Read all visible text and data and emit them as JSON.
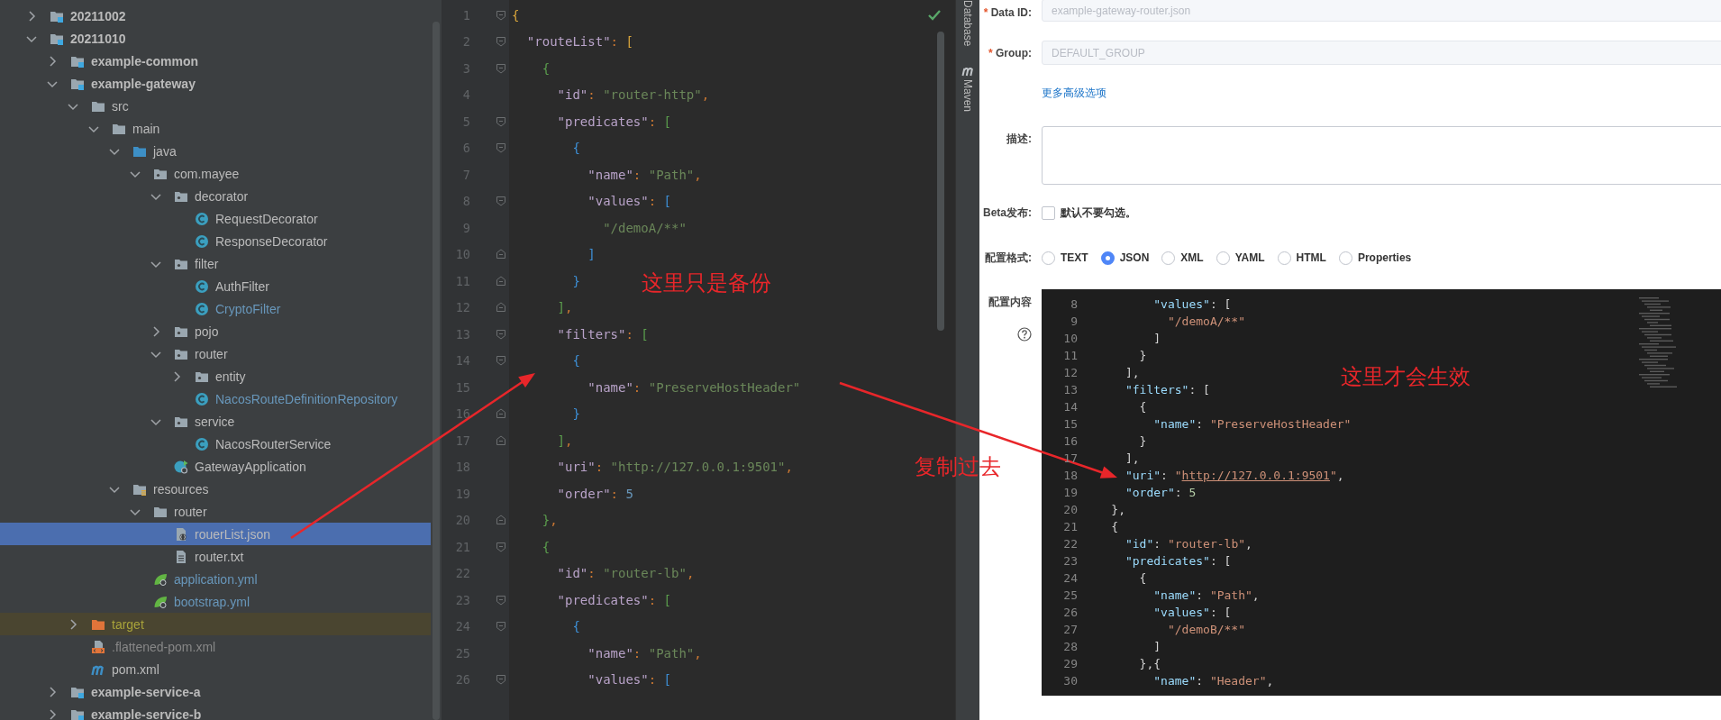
{
  "tree": [
    {
      "name": "20211002",
      "kind": "module",
      "expanded": false,
      "selected": false,
      "color": "#bbbbbb"
    },
    {
      "name": "20211010",
      "kind": "module",
      "expanded": true,
      "selected": false,
      "color": "#bbbbbb",
      "children": [
        {
          "name": "example-common",
          "kind": "module",
          "expanded": false,
          "selected": false,
          "color": "#bbbbbb"
        },
        {
          "name": "example-gateway",
          "kind": "module",
          "expanded": true,
          "selected": false,
          "color": "#bbbbbb",
          "children": [
            {
              "name": "src",
              "kind": "folder",
              "expanded": true,
              "selected": false,
              "color": "#bbbbbb",
              "children": [
                {
                  "name": "main",
                  "kind": "folder",
                  "expanded": true,
                  "selected": false,
                  "color": "#bbbbbb",
                  "children": [
                    {
                      "name": "java",
                      "kind": "source",
                      "expanded": true,
                      "selected": false,
                      "color": "#bbbbbb",
                      "children": [
                        {
                          "name": "com.mayee",
                          "kind": "package",
                          "expanded": true,
                          "selected": false,
                          "color": "#bbbbbb",
                          "children": [
                            {
                              "name": "decorator",
                              "kind": "package",
                              "expanded": true,
                              "selected": false,
                              "color": "#bbbbbb",
                              "children": [
                                {
                                  "name": "RequestDecorator",
                                  "kind": "class",
                                  "selected": false,
                                  "color": "#bbbbbb"
                                },
                                {
                                  "name": "ResponseDecorator",
                                  "kind": "class",
                                  "selected": false,
                                  "color": "#bbbbbb"
                                }
                              ]
                            },
                            {
                              "name": "filter",
                              "kind": "package",
                              "expanded": true,
                              "selected": false,
                              "color": "#bbbbbb",
                              "children": [
                                {
                                  "name": "AuthFilter",
                                  "kind": "class",
                                  "selected": false,
                                  "color": "#bbbbbb"
                                },
                                {
                                  "name": "CryptoFilter",
                                  "kind": "class",
                                  "selected": false,
                                  "color": "#6897bb"
                                }
                              ]
                            },
                            {
                              "name": "pojo",
                              "kind": "package",
                              "expanded": false,
                              "selected": false,
                              "color": "#bbbbbb"
                            },
                            {
                              "name": "router",
                              "kind": "package",
                              "expanded": true,
                              "selected": false,
                              "color": "#bbbbbb",
                              "children": [
                                {
                                  "name": "entity",
                                  "kind": "package",
                                  "expanded": false,
                                  "selected": false,
                                  "color": "#bbbbbb"
                                },
                                {
                                  "name": "NacosRouteDefinitionRepository",
                                  "kind": "class",
                                  "selected": false,
                                  "color": "#6897bb"
                                }
                              ]
                            },
                            {
                              "name": "service",
                              "kind": "package",
                              "expanded": true,
                              "selected": false,
                              "color": "#bbbbbb",
                              "children": [
                                {
                                  "name": "NacosRouterService",
                                  "kind": "class",
                                  "selected": false,
                                  "color": "#bbbbbb"
                                }
                              ]
                            },
                            {
                              "name": "GatewayApplication",
                              "kind": "app",
                              "selected": false,
                              "color": "#bbbbbb"
                            }
                          ]
                        }
                      ]
                    },
                    {
                      "name": "resources",
                      "kind": "resources",
                      "expanded": true,
                      "selected": false,
                      "color": "#bbbbbb",
                      "children": [
                        {
                          "name": "router",
                          "kind": "folder",
                          "expanded": true,
                          "selected": false,
                          "color": "#bbbbbb",
                          "children": [
                            {
                              "name": "rouerList.json",
                              "kind": "json",
                              "selected": true,
                              "color": "#bbbbbb"
                            },
                            {
                              "name": "router.txt",
                              "kind": "text",
                              "selected": false,
                              "color": "#bbbbbb"
                            }
                          ]
                        },
                        {
                          "name": "application.yml",
                          "kind": "yaml",
                          "selected": false,
                          "color": "#6897bb"
                        },
                        {
                          "name": "bootstrap.yml",
                          "kind": "yaml",
                          "selected": false,
                          "color": "#6897bb"
                        }
                      ]
                    }
                  ]
                }
              ]
            },
            {
              "name": "target",
              "kind": "excluded",
              "expanded": false,
              "selected": false,
              "color": "#a8a33a"
            },
            {
              "name": ".flattened-pom.xml",
              "kind": "xml",
              "selected": false,
              "color": "#878787"
            },
            {
              "name": "pom.xml",
              "kind": "maven",
              "selected": false,
              "color": "#bbbbbb"
            }
          ]
        },
        {
          "name": "example-service-a",
          "kind": "module",
          "expanded": false,
          "selected": false,
          "color": "#bbbbbb"
        },
        {
          "name": "example-service-b",
          "kind": "module",
          "expanded": false,
          "selected": false,
          "color": "#bbbbbb"
        }
      ]
    }
  ],
  "editor": {
    "lines": [
      {
        "number": "1",
        "fold_start": true,
        "fold_end": false,
        "tokens": [
          {
            "kind": "bracket",
            "color": "#d9a53b",
            "text": "{"
          }
        ]
      },
      {
        "number": "2",
        "fold_start": true,
        "fold_end": false,
        "tokens": [
          {
            "kind": "key",
            "text": "  \"routeList\""
          },
          {
            "kind": "punct",
            "text": ": "
          },
          {
            "kind": "bracket",
            "color": "#d9a53b",
            "text": "["
          }
        ]
      },
      {
        "number": "3",
        "fold_start": true,
        "fold_end": false,
        "tokens": [
          {
            "kind": "bracket",
            "color": "#5b9e4d",
            "text": "    {"
          }
        ]
      },
      {
        "number": "4",
        "fold_start": false,
        "fold_end": false,
        "tokens": [
          {
            "kind": "key",
            "text": "      \"id\""
          },
          {
            "kind": "punct",
            "text": ": "
          },
          {
            "kind": "string",
            "text": "\"router-http\""
          },
          {
            "kind": "punct",
            "text": ","
          }
        ]
      },
      {
        "number": "5",
        "fold_start": true,
        "fold_end": false,
        "tokens": [
          {
            "kind": "key",
            "text": "      \"predicates\""
          },
          {
            "kind": "punct",
            "text": ": "
          },
          {
            "kind": "bracket",
            "color": "#5b9e4d",
            "text": "["
          }
        ]
      },
      {
        "number": "6",
        "fold_start": true,
        "fold_end": false,
        "tokens": [
          {
            "kind": "bracket",
            "color": "#3d8fd6",
            "text": "        {"
          }
        ]
      },
      {
        "number": "7",
        "fold_start": false,
        "fold_end": false,
        "tokens": [
          {
            "kind": "key",
            "text": "          \"name\""
          },
          {
            "kind": "punct",
            "text": ": "
          },
          {
            "kind": "string",
            "text": "\"Path\""
          },
          {
            "kind": "punct",
            "text": ","
          }
        ]
      },
      {
        "number": "8",
        "fold_start": true,
        "fold_end": false,
        "tokens": [
          {
            "kind": "key",
            "text": "          \"values\""
          },
          {
            "kind": "punct",
            "text": ": "
          },
          {
            "kind": "bracket",
            "color": "#3d8fd6",
            "text": "["
          }
        ]
      },
      {
        "number": "9",
        "fold_start": false,
        "fold_end": false,
        "tokens": [
          {
            "kind": "string",
            "text": "            \"/demoA/**\""
          }
        ]
      },
      {
        "number": "10",
        "fold_start": false,
        "fold_end": true,
        "tokens": [
          {
            "kind": "bracket",
            "color": "#3d8fd6",
            "text": "          ]"
          }
        ]
      },
      {
        "number": "11",
        "fold_start": false,
        "fold_end": true,
        "tokens": [
          {
            "kind": "bracket",
            "color": "#3d8fd6",
            "text": "        }"
          }
        ]
      },
      {
        "number": "12",
        "fold_start": false,
        "fold_end": true,
        "tokens": [
          {
            "kind": "bracket",
            "color": "#5b9e4d",
            "text": "      ]"
          },
          {
            "kind": "punct",
            "text": ","
          }
        ]
      },
      {
        "number": "13",
        "fold_start": true,
        "fold_end": false,
        "tokens": [
          {
            "kind": "key",
            "text": "      \"filters\""
          },
          {
            "kind": "punct",
            "text": ": "
          },
          {
            "kind": "bracket",
            "color": "#5b9e4d",
            "text": "["
          }
        ]
      },
      {
        "number": "14",
        "fold_start": true,
        "fold_end": false,
        "tokens": [
          {
            "kind": "bracket",
            "color": "#3d8fd6",
            "text": "        {"
          }
        ]
      },
      {
        "number": "15",
        "fold_start": false,
        "fold_end": false,
        "tokens": [
          {
            "kind": "key",
            "text": "          \"name\""
          },
          {
            "kind": "punct",
            "text": ": "
          },
          {
            "kind": "string",
            "text": "\"PreserveHostHeader\""
          }
        ]
      },
      {
        "number": "16",
        "fold_start": false,
        "fold_end": true,
        "tokens": [
          {
            "kind": "bracket",
            "color": "#3d8fd6",
            "text": "        }"
          }
        ]
      },
      {
        "number": "17",
        "fold_start": false,
        "fold_end": true,
        "tokens": [
          {
            "kind": "bracket",
            "color": "#5b9e4d",
            "text": "      ]"
          },
          {
            "kind": "punct",
            "text": ","
          }
        ]
      },
      {
        "number": "18",
        "fold_start": false,
        "fold_end": false,
        "tokens": [
          {
            "kind": "key",
            "text": "      \"uri\""
          },
          {
            "kind": "punct",
            "text": ": "
          },
          {
            "kind": "string",
            "text": "\"http://127.0.0.1:9501\""
          },
          {
            "kind": "punct",
            "text": ","
          }
        ]
      },
      {
        "number": "19",
        "fold_start": false,
        "fold_end": false,
        "tokens": [
          {
            "kind": "key",
            "text": "      \"order\""
          },
          {
            "kind": "punct",
            "text": ": "
          },
          {
            "kind": "number",
            "text": "5"
          }
        ]
      },
      {
        "number": "20",
        "fold_start": false,
        "fold_end": true,
        "tokens": [
          {
            "kind": "bracket",
            "color": "#5b9e4d",
            "text": "    }"
          },
          {
            "kind": "punct",
            "text": ","
          }
        ]
      },
      {
        "number": "21",
        "fold_start": true,
        "fold_end": false,
        "tokens": [
          {
            "kind": "bracket",
            "color": "#5b9e4d",
            "text": "    {"
          }
        ]
      },
      {
        "number": "22",
        "fold_start": false,
        "fold_end": false,
        "tokens": [
          {
            "kind": "key",
            "text": "      \"id\""
          },
          {
            "kind": "punct",
            "text": ": "
          },
          {
            "kind": "string",
            "text": "\"router-lb\""
          },
          {
            "kind": "punct",
            "text": ","
          }
        ]
      },
      {
        "number": "23",
        "fold_start": true,
        "fold_end": false,
        "tokens": [
          {
            "kind": "key",
            "text": "      \"predicates\""
          },
          {
            "kind": "punct",
            "text": ": "
          },
          {
            "kind": "bracket",
            "color": "#5b9e4d",
            "text": "["
          }
        ]
      },
      {
        "number": "24",
        "fold_start": true,
        "fold_end": false,
        "tokens": [
          {
            "kind": "bracket",
            "color": "#3d8fd6",
            "text": "        {"
          }
        ]
      },
      {
        "number": "25",
        "fold_start": false,
        "fold_end": false,
        "tokens": [
          {
            "kind": "key",
            "text": "          \"name\""
          },
          {
            "kind": "punct",
            "text": ": "
          },
          {
            "kind": "string",
            "text": "\"Path\""
          },
          {
            "kind": "punct",
            "text": ","
          }
        ]
      },
      {
        "number": "26",
        "fold_start": true,
        "fold_end": false,
        "tokens": [
          {
            "kind": "key",
            "text": "          \"values\""
          },
          {
            "kind": "punct",
            "text": ": "
          },
          {
            "kind": "bracket",
            "color": "#3d8fd6",
            "text": "["
          }
        ]
      }
    ]
  },
  "tool_windows": [
    {
      "label": "Database",
      "kind": "plain"
    },
    {
      "label": "Maven",
      "kind": "maven"
    }
  ],
  "config_form": {
    "data_id": {
      "marker": "*",
      "label": "Data ID:",
      "value": "example-gateway-router.json",
      "disabled": true
    },
    "group": {
      "marker": "*",
      "label": "Group:",
      "value": "DEFAULT_GROUP",
      "disabled": true
    },
    "advanced_link": "更多高级选项",
    "description": {
      "label": "描述:"
    },
    "beta": {
      "label": "Beta发布:",
      "checked": false,
      "hint": "默认不要勾选。"
    },
    "format": {
      "label": "配置格式:",
      "options": [
        {
          "label": "TEXT",
          "selected": false
        },
        {
          "label": "JSON",
          "selected": true
        },
        {
          "label": "XML",
          "selected": false
        },
        {
          "label": "YAML",
          "selected": false
        },
        {
          "label": "HTML",
          "selected": false
        },
        {
          "label": "Properties",
          "selected": false
        }
      ]
    },
    "content": {
      "label": "配置内容",
      "lines": [
        {
          "number": "8",
          "tokens": [
            {
              "kind": "key",
              "text": "          \"values\""
            },
            {
              "kind": "punct",
              "text": ": ["
            }
          ]
        },
        {
          "number": "9",
          "tokens": [
            {
              "kind": "string",
              "text": "            \"/demoA/**\""
            }
          ]
        },
        {
          "number": "10",
          "tokens": [
            {
              "kind": "punct",
              "text": "          ]"
            }
          ]
        },
        {
          "number": "11",
          "tokens": [
            {
              "kind": "punct",
              "text": "        }"
            }
          ]
        },
        {
          "number": "12",
          "tokens": [
            {
              "kind": "punct",
              "text": "      ],"
            }
          ]
        },
        {
          "number": "13",
          "tokens": [
            {
              "kind": "key",
              "text": "      \"filters\""
            },
            {
              "kind": "punct",
              "text": ": ["
            }
          ]
        },
        {
          "number": "14",
          "tokens": [
            {
              "kind": "punct",
              "text": "        {"
            }
          ]
        },
        {
          "number": "15",
          "tokens": [
            {
              "kind": "key",
              "text": "          \"name\""
            },
            {
              "kind": "punct",
              "text": ": "
            },
            {
              "kind": "string",
              "text": "\"PreserveHostHeader\""
            }
          ]
        },
        {
          "number": "16",
          "tokens": [
            {
              "kind": "punct",
              "text": "        }"
            }
          ]
        },
        {
          "number": "17",
          "tokens": [
            {
              "kind": "punct",
              "text": "      ],"
            }
          ]
        },
        {
          "number": "18",
          "tokens": [
            {
              "kind": "key",
              "text": "      \"uri\""
            },
            {
              "kind": "punct",
              "text": ": "
            },
            {
              "kind": "string",
              "text": "\""
            },
            {
              "kind": "link",
              "text": "http://127.0.0.1:9501"
            },
            {
              "kind": "string",
              "text": "\""
            },
            {
              "kind": "punct",
              "text": ","
            }
          ]
        },
        {
          "number": "19",
          "tokens": [
            {
              "kind": "key",
              "text": "      \"order\""
            },
            {
              "kind": "punct",
              "text": ": "
            },
            {
              "kind": "number",
              "text": "5"
            }
          ]
        },
        {
          "number": "20",
          "tokens": [
            {
              "kind": "punct",
              "text": "    },"
            }
          ]
        },
        {
          "number": "21",
          "tokens": [
            {
              "kind": "punct",
              "text": "    {"
            }
          ]
        },
        {
          "number": "22",
          "tokens": [
            {
              "kind": "key",
              "text": "      \"id\""
            },
            {
              "kind": "punct",
              "text": ": "
            },
            {
              "kind": "string",
              "text": "\"router-lb\""
            },
            {
              "kind": "punct",
              "text": ","
            }
          ]
        },
        {
          "number": "23",
          "tokens": [
            {
              "kind": "key",
              "text": "      \"predicates\""
            },
            {
              "kind": "punct",
              "text": ": ["
            }
          ]
        },
        {
          "number": "24",
          "tokens": [
            {
              "kind": "punct",
              "text": "        {"
            }
          ]
        },
        {
          "number": "25",
          "tokens": [
            {
              "kind": "key",
              "text": "          \"name\""
            },
            {
              "kind": "punct",
              "text": ": "
            },
            {
              "kind": "string",
              "text": "\"Path\""
            },
            {
              "kind": "punct",
              "text": ","
            }
          ]
        },
        {
          "number": "26",
          "tokens": [
            {
              "kind": "key",
              "text": "          \"values\""
            },
            {
              "kind": "punct",
              "text": ": ["
            }
          ]
        },
        {
          "number": "27",
          "tokens": [
            {
              "kind": "string",
              "text": "            \"/demoB/**\""
            }
          ]
        },
        {
          "number": "28",
          "tokens": [
            {
              "kind": "punct",
              "text": "          ]"
            }
          ]
        },
        {
          "number": "29",
          "tokens": [
            {
              "kind": "punct",
              "text": "        },{"
            }
          ]
        },
        {
          "number": "30",
          "tokens": [
            {
              "kind": "key",
              "text": "          \"name\""
            },
            {
              "kind": "punct",
              "text": ": "
            },
            {
              "kind": "string",
              "text": "\"Header\""
            },
            {
              "kind": "punct",
              "text": ","
            }
          ]
        }
      ]
    }
  },
  "annotations": [
    {
      "text": "这里只是备份"
    },
    {
      "text": "复制过去"
    },
    {
      "text": "这里才会生效"
    }
  ]
}
